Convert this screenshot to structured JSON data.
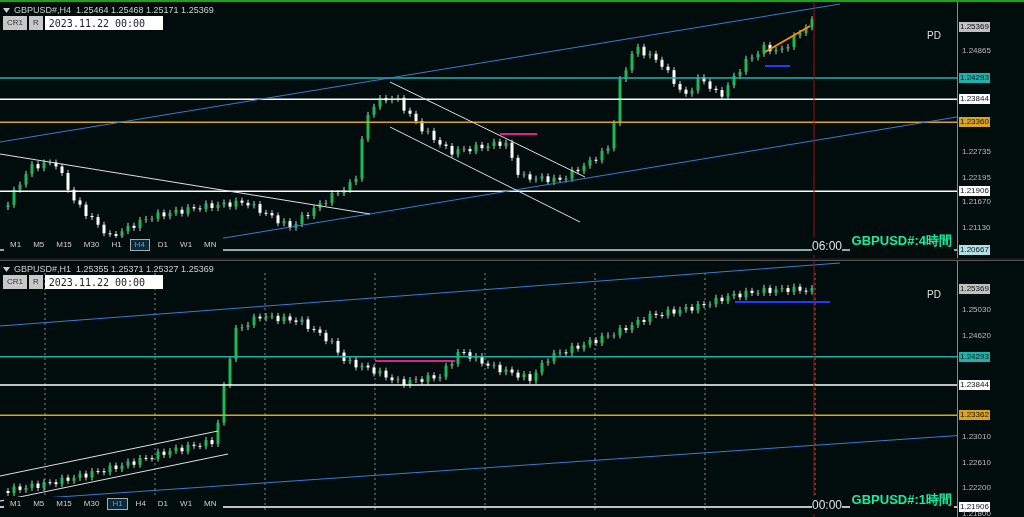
{
  "panels": [
    {
      "header": "GBPUSD#,H4  1.25464 1.25468 1.25171 1.25369",
      "buttons": [
        "CR1",
        "R"
      ],
      "date_field": {
        "value": "2023.11.22 00:00"
      },
      "indicator_label": "PD",
      "symbol_label": "GBPUSD#:4時間",
      "time_label": "06:00",
      "price_axis": [
        {
          "kind": "tag",
          "text": "1.25369",
          "color": "#c0c0c0"
        },
        {
          "kind": "tick",
          "text": "1.24865"
        },
        {
          "kind": "tag",
          "text": "1.24293",
          "color": "#20b2aa"
        },
        {
          "kind": "tag",
          "text": "1.23844",
          "color": "#ffffff"
        },
        {
          "kind": "tag",
          "text": "1.23360",
          "color": "#daa520"
        },
        {
          "kind": "tick",
          "text": "1.22735"
        },
        {
          "kind": "tick",
          "text": "1.22195"
        },
        {
          "kind": "tag",
          "text": "1.21906",
          "color": "#ffffff"
        },
        {
          "kind": "tick",
          "text": "1.21670"
        },
        {
          "kind": "tick",
          "text": "1.21130"
        },
        {
          "kind": "tag",
          "text": "1.20667",
          "color": "#b0e0e6"
        }
      ],
      "timeframes": [
        {
          "label": "M1",
          "selected": false
        },
        {
          "label": "M5",
          "selected": false
        },
        {
          "label": "M15",
          "selected": false
        },
        {
          "label": "M30",
          "selected": false
        },
        {
          "label": "H1",
          "selected": false
        },
        {
          "label": "H4",
          "selected": true
        },
        {
          "label": "D1",
          "selected": false
        },
        {
          "label": "W1",
          "selected": false
        },
        {
          "label": "MN",
          "selected": false
        }
      ]
    },
    {
      "header": "GBPUSD#,H1  1.25355 1.25371 1.25327 1.25369",
      "buttons": [
        "CR1",
        "R"
      ],
      "date_field": {
        "value": "2023.11.22 00:00"
      },
      "indicator_label": "PD",
      "symbol_label": "GBPUSD#:1時間",
      "time_label": "00:00",
      "price_axis": [
        {
          "kind": "tag",
          "text": "1.25369",
          "color": "#c0c0c0"
        },
        {
          "kind": "tick",
          "text": "1.25030"
        },
        {
          "kind": "tick",
          "text": "1.24620"
        },
        {
          "kind": "tag",
          "text": "1.24293",
          "color": "#20b2aa"
        },
        {
          "kind": "tag",
          "text": "1.23844",
          "color": "#ffffff"
        },
        {
          "kind": "tag",
          "text": "1.23362",
          "color": "#daa520"
        },
        {
          "kind": "tick",
          "text": "1.23010"
        },
        {
          "kind": "tick",
          "text": "1.22610"
        },
        {
          "kind": "tick",
          "text": "1.22200"
        },
        {
          "kind": "tag",
          "text": "1.21906",
          "color": "#ffffff"
        },
        {
          "kind": "tick",
          "text": "1.21800"
        }
      ],
      "timeframes": [
        {
          "label": "M1",
          "selected": false
        },
        {
          "label": "M5",
          "selected": false
        },
        {
          "label": "M15",
          "selected": false
        },
        {
          "label": "M30",
          "selected": false
        },
        {
          "label": "H1",
          "selected": true
        },
        {
          "label": "H4",
          "selected": false
        },
        {
          "label": "D1",
          "selected": false
        },
        {
          "label": "W1",
          "selected": false
        },
        {
          "label": "MN",
          "selected": false
        }
      ]
    }
  ]
}
